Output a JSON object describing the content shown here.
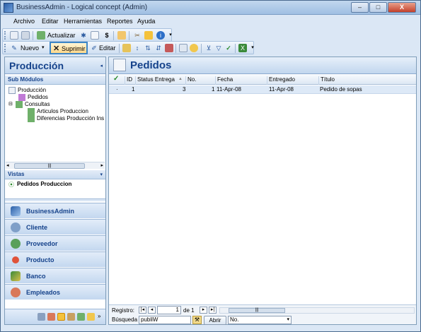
{
  "window": {
    "title": "BusinessAdmin - Logical concept (Admin)",
    "min": "–",
    "max": "□",
    "close": "X"
  },
  "menu": [
    "Archivo",
    "Editar",
    "Herramientas",
    "Reportes",
    "Ayuda"
  ],
  "toolbar1": {
    "actualizar": "Actualizar",
    "dollar": "$"
  },
  "toolbar2": {
    "nuevo": "Nuevo",
    "suprimir": "Suprimir",
    "editar": "Editar"
  },
  "left": {
    "title": "Producción",
    "sub_modulos": "Sub Módulos",
    "tree": {
      "root": "Producción",
      "pedidos": "Pedidos",
      "consultas": "Consultas",
      "articulos": "Articulos Produccion",
      "diferencias": "Diferencias Producción Ins"
    },
    "vistas": "Vistas",
    "vista_item": "Pedidos Produccion",
    "nav": [
      "BusinessAdmin",
      "Cliente",
      "Proveedor",
      "Producto",
      "Banco",
      "Empleados"
    ]
  },
  "right": {
    "title": "Pedidos",
    "columns": [
      "ID",
      "Status Entrega",
      "No.",
      "Fecha",
      "Entregado",
      "Título"
    ],
    "rows": [
      {
        "id": "1",
        "status": "3",
        "no": "1",
        "fecha": "11-Apr-08",
        "entregado": "11-Apr-08",
        "titulo": "Pedido de sopas"
      }
    ],
    "status": {
      "registro": "Registro:",
      "current": "1",
      "of": "de 1",
      "busqueda": "Búsqueda",
      "search_value": "publiW",
      "abrir": "Abrir",
      "select": "No."
    }
  },
  "colors": {
    "accent": "#15428b",
    "window_bg": "#dbe7f5",
    "selected_row": "#dde9f7"
  }
}
